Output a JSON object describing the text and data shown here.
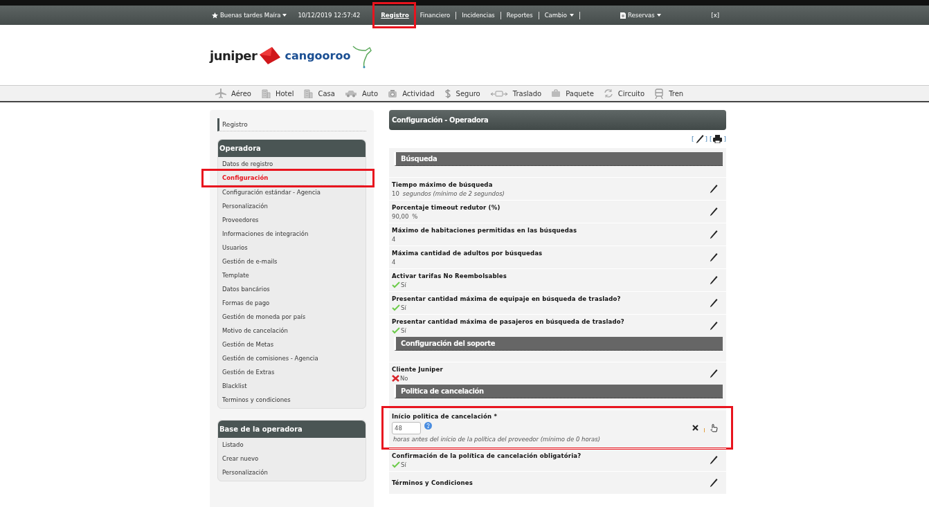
{
  "top_bar": {
    "greeting": "Buenas tardes Maíra",
    "datetime": "10/12/2019 12:57:42",
    "links": [
      {
        "label": "Registro",
        "selected": true,
        "highlighted": true,
        "caret": false
      },
      {
        "label": "Financiero",
        "selected": false,
        "highlighted": false,
        "caret": false
      },
      {
        "label": "Incidencias",
        "selected": false,
        "highlighted": false,
        "caret": false
      },
      {
        "label": "Reportes",
        "selected": false,
        "highlighted": false,
        "caret": false
      },
      {
        "label": "Cambio",
        "selected": false,
        "highlighted": false,
        "caret": true
      }
    ],
    "reservas": "Reservas",
    "close": "[x]"
  },
  "logo": {
    "brand": "juniper",
    "partner": "cangooroo"
  },
  "products": [
    {
      "label": "Aéreo",
      "kind": "plane"
    },
    {
      "label": "Hotel",
      "kind": "building"
    },
    {
      "label": "Casa",
      "kind": "building"
    },
    {
      "label": "Auto",
      "kind": "car"
    },
    {
      "label": "Actividad",
      "kind": "camera"
    },
    {
      "label": "Seguro",
      "kind": "dollar"
    },
    {
      "label": "Traslado",
      "kind": "transfer"
    },
    {
      "label": "Paquete",
      "kind": "briefcase"
    },
    {
      "label": "Circuito",
      "kind": "cycle"
    },
    {
      "label": "Tren",
      "kind": "train"
    }
  ],
  "sidebar": {
    "breadcrumb": "Registro",
    "groups": [
      {
        "title": "Operadora",
        "items": [
          {
            "label": "Datos de registro",
            "selected": false,
            "highlighted": false
          },
          {
            "label": "Configuración",
            "selected": true,
            "highlighted": true
          },
          {
            "label": "Configuración estándar - Agencia",
            "selected": false,
            "highlighted": false
          },
          {
            "label": "Personalización",
            "selected": false,
            "highlighted": false
          },
          {
            "label": "Proveedores",
            "selected": false,
            "highlighted": false
          },
          {
            "label": "Informaciones de integración",
            "selected": false,
            "highlighted": false
          },
          {
            "label": "Usuarios",
            "selected": false,
            "highlighted": false
          },
          {
            "label": "Gestión de e-mails",
            "selected": false,
            "highlighted": false
          },
          {
            "label": "Template",
            "selected": false,
            "highlighted": false
          },
          {
            "label": "Datos bancários",
            "selected": false,
            "highlighted": false
          },
          {
            "label": "Formas de pago",
            "selected": false,
            "highlighted": false
          },
          {
            "label": "Gestión de moneda por país",
            "selected": false,
            "highlighted": false
          },
          {
            "label": "Motivo de cancelación",
            "selected": false,
            "highlighted": false
          },
          {
            "label": "Gestión de Metas",
            "selected": false,
            "highlighted": false
          },
          {
            "label": "Gestión de comisiones - Agencia",
            "selected": false,
            "highlighted": false
          },
          {
            "label": "Gestión de Extras",
            "selected": false,
            "highlighted": false
          },
          {
            "label": "Blacklist",
            "selected": false,
            "highlighted": false
          },
          {
            "label": "Terminos y condiciones",
            "selected": false,
            "highlighted": false
          }
        ]
      },
      {
        "title": "Base de la operadora",
        "items": [
          {
            "label": "Listado",
            "selected": false,
            "highlighted": false
          },
          {
            "label": "Crear nuevo",
            "selected": false,
            "highlighted": false
          },
          {
            "label": "Personalización",
            "selected": false,
            "highlighted": false
          }
        ]
      }
    ]
  },
  "main": {
    "title": "Configuración - Operadora",
    "tool_brackets": [
      "[",
      "] [",
      "]"
    ],
    "sections": [
      {
        "title": "Búsqueda",
        "rows": [
          {
            "kind": "value",
            "label": "Tiempo máximo de búsqueda",
            "value": "10",
            "note": "segundos (mínimo de 2 segundos)"
          },
          {
            "kind": "value",
            "label": "Porcentaje timeout redutor (%)",
            "value": "90,00",
            "unit": "%"
          },
          {
            "kind": "value",
            "label": "Máximo de habitaciones permitidas en las búsquedas",
            "value": "4"
          },
          {
            "kind": "value",
            "label": "Máxima cantidad de adultos por búsquedas",
            "value": "4"
          },
          {
            "kind": "flag",
            "label": "Activar tarifas No Reembolsables",
            "on": true,
            "value": "Sí"
          },
          {
            "kind": "flag",
            "label": "Presentar cantidad máxima de equipaje en búsqueda de traslado?",
            "on": true,
            "value": "Sí"
          },
          {
            "kind": "flag",
            "label": "Presentar cantidad máxima de pasajeros en búsqueda de traslado?",
            "on": true,
            "value": "Sí"
          }
        ]
      },
      {
        "title": "Configuración del soporte",
        "rows": [
          {
            "kind": "flag",
            "label": "Cliente Juniper",
            "on": false,
            "value": "No"
          }
        ]
      },
      {
        "title": "Politica de cancelación",
        "rows": [
          {
            "kind": "input",
            "label": "Início politica de cancelación *",
            "value": "48",
            "note": "horas antes del início de la política del proveedor (mínimo de 0 horas)",
            "highlighted": true
          },
          {
            "kind": "flag",
            "label": "Confirmación de la política de cancelación obligatória?",
            "on": true,
            "value": "Sí"
          },
          {
            "kind": "empty",
            "label": "Términos y Condiciones"
          }
        ]
      }
    ]
  }
}
